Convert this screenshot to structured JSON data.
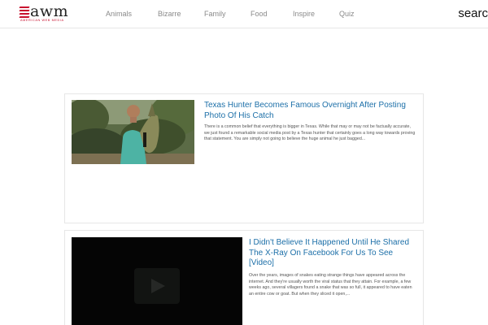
{
  "logo": {
    "text": "awm",
    "subtitle": "AMERICAN WEB MEDIA",
    "accent_color": "#c8102e"
  },
  "nav": {
    "items": [
      {
        "label": "Animals"
      },
      {
        "label": "Bizarre"
      },
      {
        "label": "Family"
      },
      {
        "label": "Food"
      },
      {
        "label": "Inspire"
      },
      {
        "label": "Quiz"
      }
    ],
    "search_label": "searc"
  },
  "articles": [
    {
      "title": "Texas Hunter Becomes Famous Overnight After Posting Photo Of His Catch",
      "excerpt": "There is a common belief that everything is bigger in Texas. While that may or may not be factually accurate, we just found a remarkable social media post by a Texas hunter that certainly goes a long way towards proving that statement. You are simply not going to believe the huge animal he just bagged...",
      "media": "photo"
    },
    {
      "title": "I Didn't Believe It Happened Until He Shared The X-Ray On Facebook For Us To See [Video]",
      "excerpt": "Over the years, images of snakes eating strange things have appeared across the internet. And they're usually worth the viral status that they attain. For example, a few weeks ago, several villagers found a snake that was so full, it appeared to have eaten an entire cow or goat. But when they sliced it open,...",
      "media": "video",
      "media_icon": "play-icon"
    }
  ],
  "colors": {
    "title_link": "#1c6fa8",
    "nav_text": "#8a8a8a"
  }
}
